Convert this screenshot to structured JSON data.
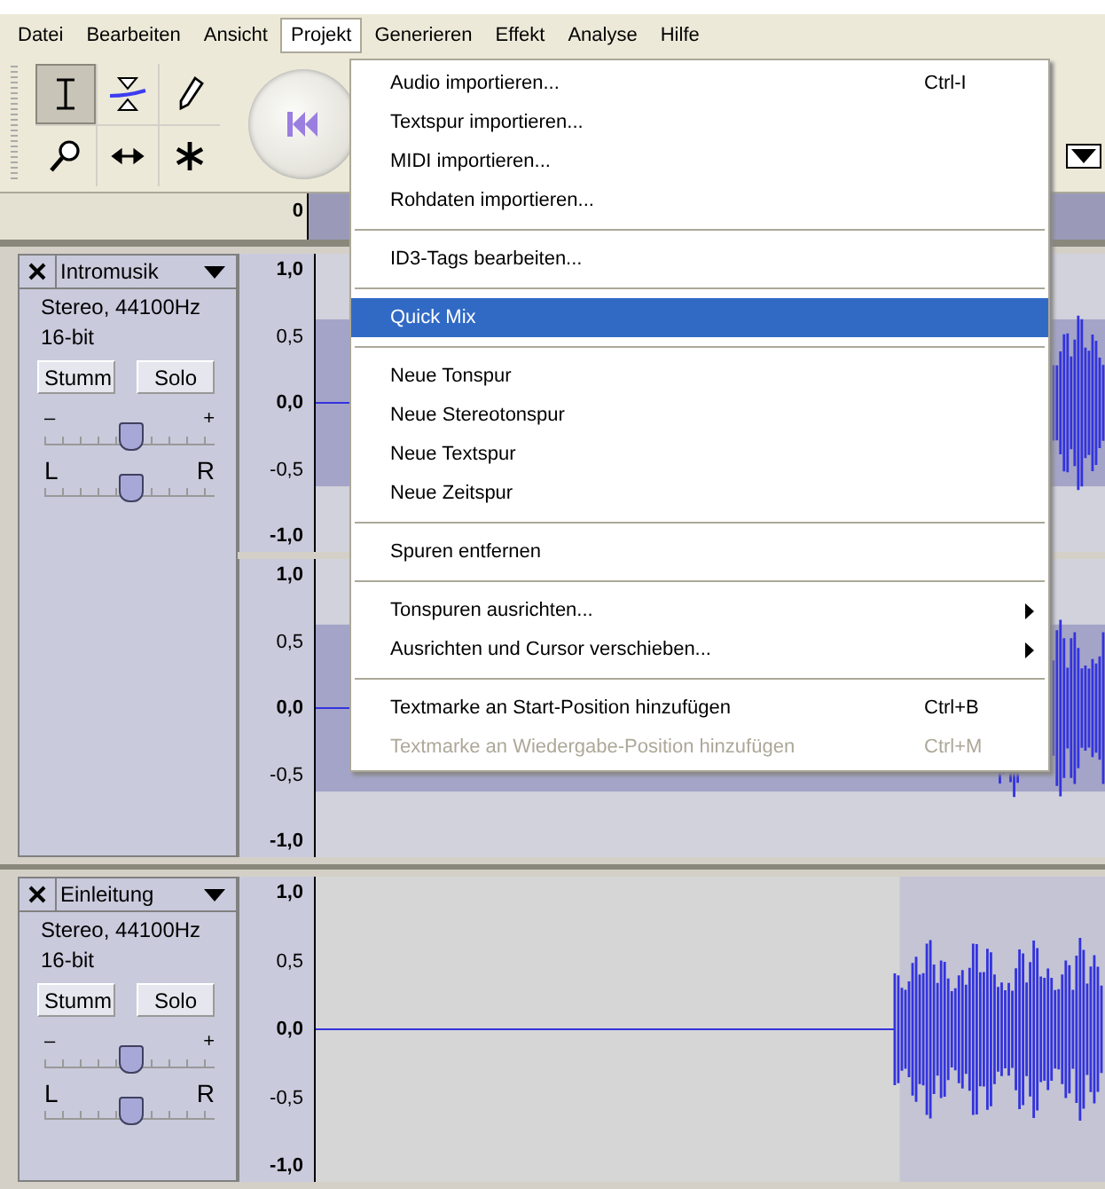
{
  "menubar": [
    {
      "label": "Datei",
      "selected": false
    },
    {
      "label": "Bearbeiten",
      "selected": false
    },
    {
      "label": "Ansicht",
      "selected": false
    },
    {
      "label": "Projekt",
      "selected": true
    },
    {
      "label": "Generieren",
      "selected": false
    },
    {
      "label": "Effekt",
      "selected": false
    },
    {
      "label": "Analyse",
      "selected": false
    },
    {
      "label": "Hilfe",
      "selected": false
    }
  ],
  "tools": [
    {
      "kind": "select",
      "selected": true
    },
    {
      "kind": "envelope",
      "selected": false
    },
    {
      "kind": "draw",
      "selected": false
    },
    {
      "kind": "zoom",
      "selected": false
    },
    {
      "kind": "timeshift",
      "selected": false
    },
    {
      "kind": "multi",
      "selected": false
    }
  ],
  "ruler": {
    "label": "0"
  },
  "tracks": [
    {
      "name": "Intromusik",
      "info": [
        "Stereo, 44100Hz",
        "16-bit"
      ],
      "buttons": [
        "Stumm",
        "Solo"
      ],
      "gain": {
        "min_label": "–",
        "max_label": "+",
        "level": 0.5
      },
      "pan": {
        "left_label": "L",
        "right_label": "R",
        "level": 0.5
      },
      "channels": [
        {
          "ticks": [
            {
              "label": "1,0",
              "major": true
            },
            {
              "label": "0,5",
              "major": false
            },
            {
              "label": "0,0",
              "major": true
            },
            {
              "label": "-0,5",
              "major": false
            },
            {
              "label": "-1,0",
              "major": true
            }
          ]
        },
        {
          "ticks": [
            {
              "label": "1,0",
              "major": true
            },
            {
              "label": "0,5",
              "major": false
            },
            {
              "label": "0,0",
              "major": true
            },
            {
              "label": "-0,5",
              "major": false
            },
            {
              "label": "-1,0",
              "major": true
            }
          ]
        }
      ]
    },
    {
      "name": "Einleitung",
      "info": [
        "Stereo, 44100Hz",
        "16-bit"
      ],
      "buttons": [
        "Stumm",
        "Solo"
      ],
      "gain": {
        "min_label": "–",
        "max_label": "+",
        "level": 0.5
      },
      "pan": {
        "left_label": "L",
        "right_label": "R",
        "level": 0.5
      },
      "channels": [
        {
          "selection": {
            "level": 0.26
          },
          "ticks": [
            {
              "label": "1,0",
              "major": true
            },
            {
              "label": "0,5",
              "major": false
            },
            {
              "label": "0,0",
              "major": true
            },
            {
              "label": "-0,5",
              "major": false
            },
            {
              "label": "-1,0",
              "major": true
            }
          ]
        }
      ]
    }
  ],
  "menu": [
    {
      "kind": "item",
      "label": "Audio importieren...",
      "shortcut": "Ctrl-I",
      "selected": false,
      "disabled": false,
      "submenu": false
    },
    {
      "kind": "item",
      "label": "Textspur importieren...",
      "selected": false,
      "disabled": false,
      "submenu": false
    },
    {
      "kind": "item",
      "label": "MIDI importieren...",
      "selected": false,
      "disabled": false,
      "submenu": false
    },
    {
      "kind": "item",
      "label": "Rohdaten importieren...",
      "selected": false,
      "disabled": false,
      "submenu": false
    },
    {
      "kind": "separator"
    },
    {
      "kind": "item",
      "label": "ID3-Tags bearbeiten...",
      "selected": false,
      "disabled": false,
      "submenu": false
    },
    {
      "kind": "separator"
    },
    {
      "kind": "item",
      "label": "Quick Mix",
      "selected": true,
      "disabled": false,
      "submenu": false
    },
    {
      "kind": "separator"
    },
    {
      "kind": "item",
      "label": "Neue Tonspur",
      "selected": false,
      "disabled": false,
      "submenu": false
    },
    {
      "kind": "item",
      "label": "Neue Stereotonspur",
      "selected": false,
      "disabled": false,
      "submenu": false
    },
    {
      "kind": "item",
      "label": "Neue Textspur",
      "selected": false,
      "disabled": false,
      "submenu": false
    },
    {
      "kind": "item",
      "label": "Neue Zeitspur",
      "selected": false,
      "disabled": false,
      "submenu": false
    },
    {
      "kind": "separator"
    },
    {
      "kind": "item",
      "label": "Spuren entfernen",
      "selected": false,
      "disabled": false,
      "submenu": false
    },
    {
      "kind": "separator"
    },
    {
      "kind": "item",
      "label": "Tonspuren ausrichten...",
      "selected": false,
      "disabled": false,
      "submenu": true
    },
    {
      "kind": "item",
      "label": "Ausrichten und Cursor verschieben...",
      "selected": false,
      "disabled": false,
      "submenu": true
    },
    {
      "kind": "separator"
    },
    {
      "kind": "item",
      "label": "Textmarke an Start-Position hinzufügen",
      "shortcut": "Ctrl+B",
      "selected": false,
      "disabled": false,
      "submenu": false
    },
    {
      "kind": "item",
      "label": "Textmarke an Wiedergabe-Position hinzufügen",
      "shortcut": "Ctrl+M",
      "selected": false,
      "disabled": true,
      "submenu": false
    }
  ]
}
